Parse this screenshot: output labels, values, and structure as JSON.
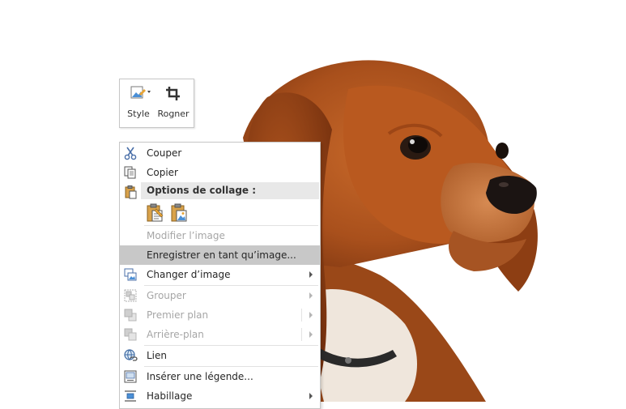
{
  "mini_toolbar": {
    "style_label": "Style",
    "crop_label": "Rogner"
  },
  "context_menu": {
    "cut": "Couper",
    "copy": "Copier",
    "paste_options": "Options de collage :",
    "edit_image": "Modifier l’image",
    "save_as_image": "Enregistrer en tant qu’image...",
    "change_image": "Changer d’image",
    "group": "Grouper",
    "bring_forward": "Premier plan",
    "send_backward": "Arrière-plan",
    "link": "Lien",
    "insert_caption": "Insérer une légende...",
    "wrap_text": "Habillage"
  },
  "icons": {
    "cut": "scissors-icon",
    "copy": "copy-icon",
    "paste": "clipboard-icon",
    "paste_keep_formatting": "paste-keep-source-icon",
    "paste_picture": "paste-picture-icon",
    "change_image": "change-picture-icon",
    "group": "group-icon",
    "bring_forward": "bring-forward-icon",
    "send_backward": "send-backward-icon",
    "link": "link-globe-icon",
    "insert_caption": "caption-icon",
    "wrap_text": "wrap-text-icon"
  }
}
